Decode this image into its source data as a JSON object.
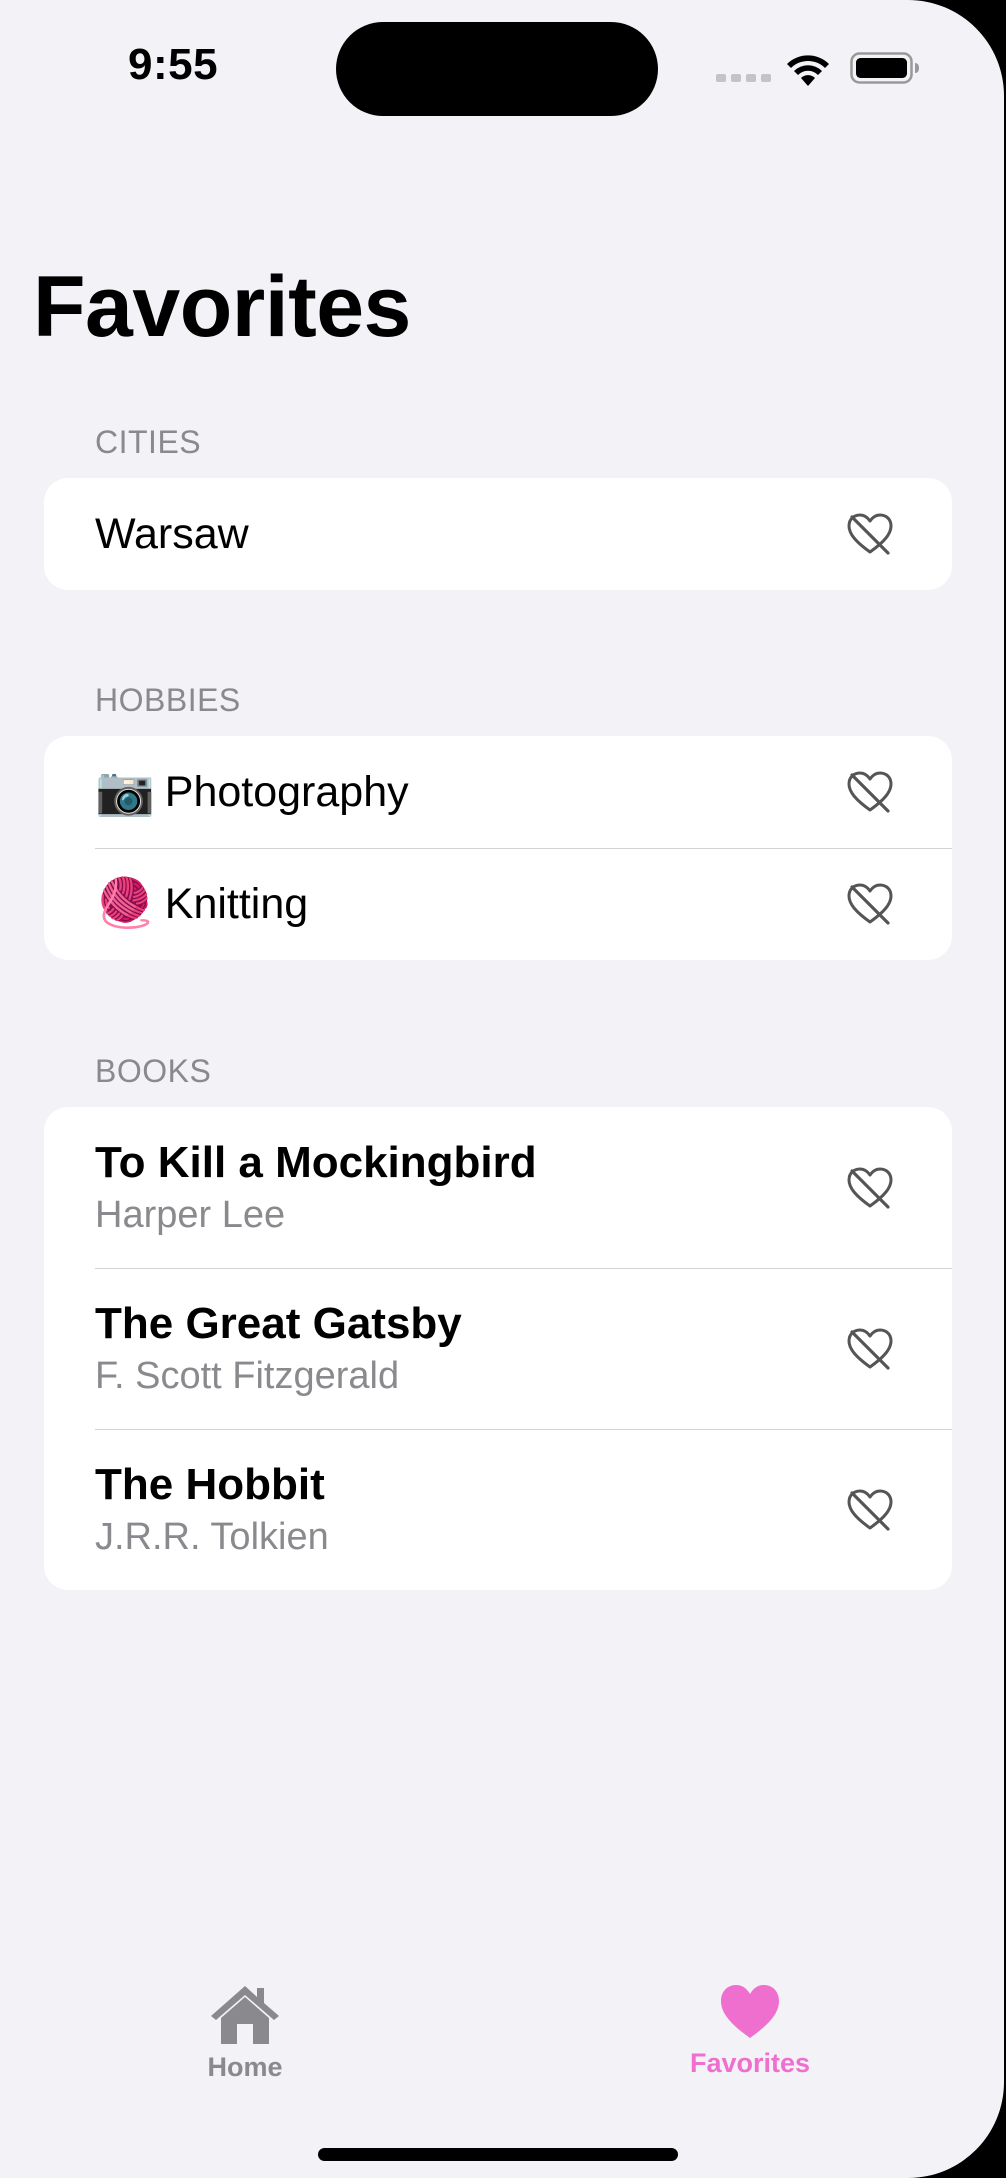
{
  "status_bar": {
    "time": "9:55"
  },
  "page": {
    "title": "Favorites"
  },
  "sections": {
    "cities": {
      "header": "CITIES",
      "items": [
        {
          "label": "Warsaw"
        }
      ]
    },
    "hobbies": {
      "header": "HOBBIES",
      "items": [
        {
          "emoji": "📷",
          "label": "Photography"
        },
        {
          "emoji": "🧶",
          "label": "Knitting"
        }
      ]
    },
    "books": {
      "header": "BOOKS",
      "items": [
        {
          "title": "To Kill a Mockingbird",
          "author": "Harper Lee"
        },
        {
          "title": "The Great Gatsby",
          "author": "F. Scott Fitzgerald"
        },
        {
          "title": "The Hobbit",
          "author": "J.R.R. Tolkien"
        }
      ]
    }
  },
  "tab_bar": {
    "tabs": [
      {
        "label": "Home",
        "icon": "house-icon",
        "selected": false
      },
      {
        "label": "Favorites",
        "icon": "heart-icon",
        "selected": true
      }
    ]
  },
  "colors": {
    "background": "#f2f2f7",
    "accent": "#ef6fcf",
    "inactive_tab": "#8a8a8e",
    "secondary_text": "#8a8a8e"
  }
}
